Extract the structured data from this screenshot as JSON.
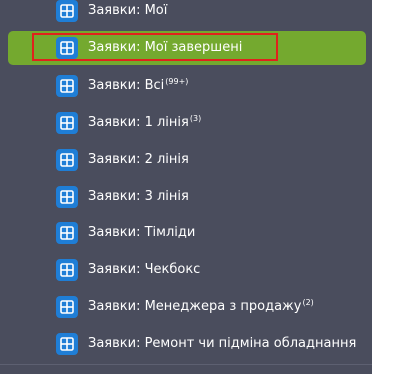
{
  "sidebar": {
    "items": [
      {
        "label": "Заявки: Мої",
        "badge": ""
      },
      {
        "label": "Заявки: Мої завершені",
        "badge": ""
      },
      {
        "label": "Заявки: Всі",
        "badge": "(99+)"
      },
      {
        "label": "Заявки: 1 лінія",
        "badge": "(3)"
      },
      {
        "label": "Заявки: 2 лінія",
        "badge": ""
      },
      {
        "label": "Заявки: 3 лінія",
        "badge": ""
      },
      {
        "label": "Заявки: Тімліди",
        "badge": ""
      },
      {
        "label": "Заявки: Чекбокс",
        "badge": ""
      },
      {
        "label": "Заявки: Менеджера з продажу",
        "badge": "(2)"
      },
      {
        "label": "Заявки: Ремонт чи підміна обладнання",
        "badge": ""
      }
    ],
    "active_index": 1
  },
  "colors": {
    "sidebar_bg": "#4a4d5d",
    "active_bg": "#74a92f",
    "icon_bg": "#1f7ed6",
    "highlight_border": "#e0221c"
  },
  "icons": {
    "item_icon": "grid-icon"
  }
}
